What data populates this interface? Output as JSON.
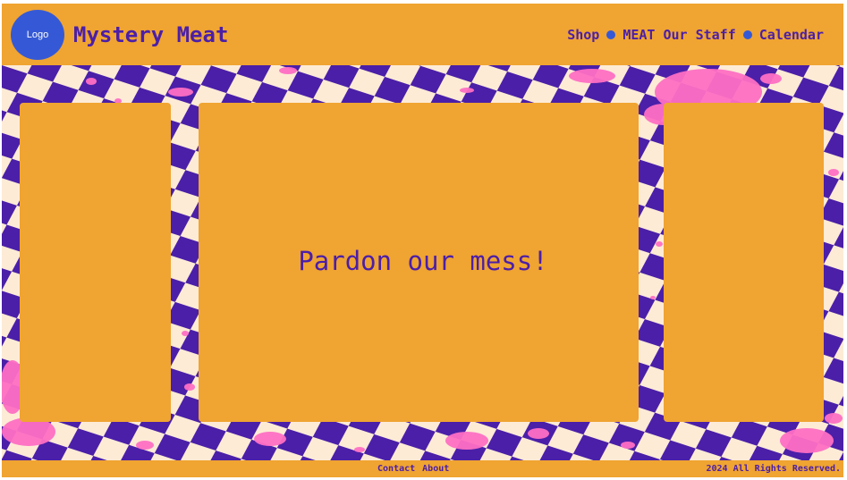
{
  "header": {
    "logo_text": "Logo",
    "title": "Mystery Meat",
    "nav": [
      {
        "label": "Shop"
      },
      {
        "label": "MEAT Our Staff"
      },
      {
        "label": "Calendar"
      }
    ]
  },
  "main": {
    "message": "Pardon our mess!"
  },
  "footer": {
    "links": [
      {
        "label": "Contact"
      },
      {
        "label": "About"
      }
    ],
    "copyright": "2024 All Rights Reserved."
  },
  "colors": {
    "accent": "#F0A431",
    "text": "#4B1FA8",
    "logo": "#3559D6",
    "checker_dark": "#4B1FA8",
    "checker_light": "#FDEBD6",
    "splatter": "#FF6FC4"
  },
  "icons": [
    "nav-dot-icon"
  ]
}
